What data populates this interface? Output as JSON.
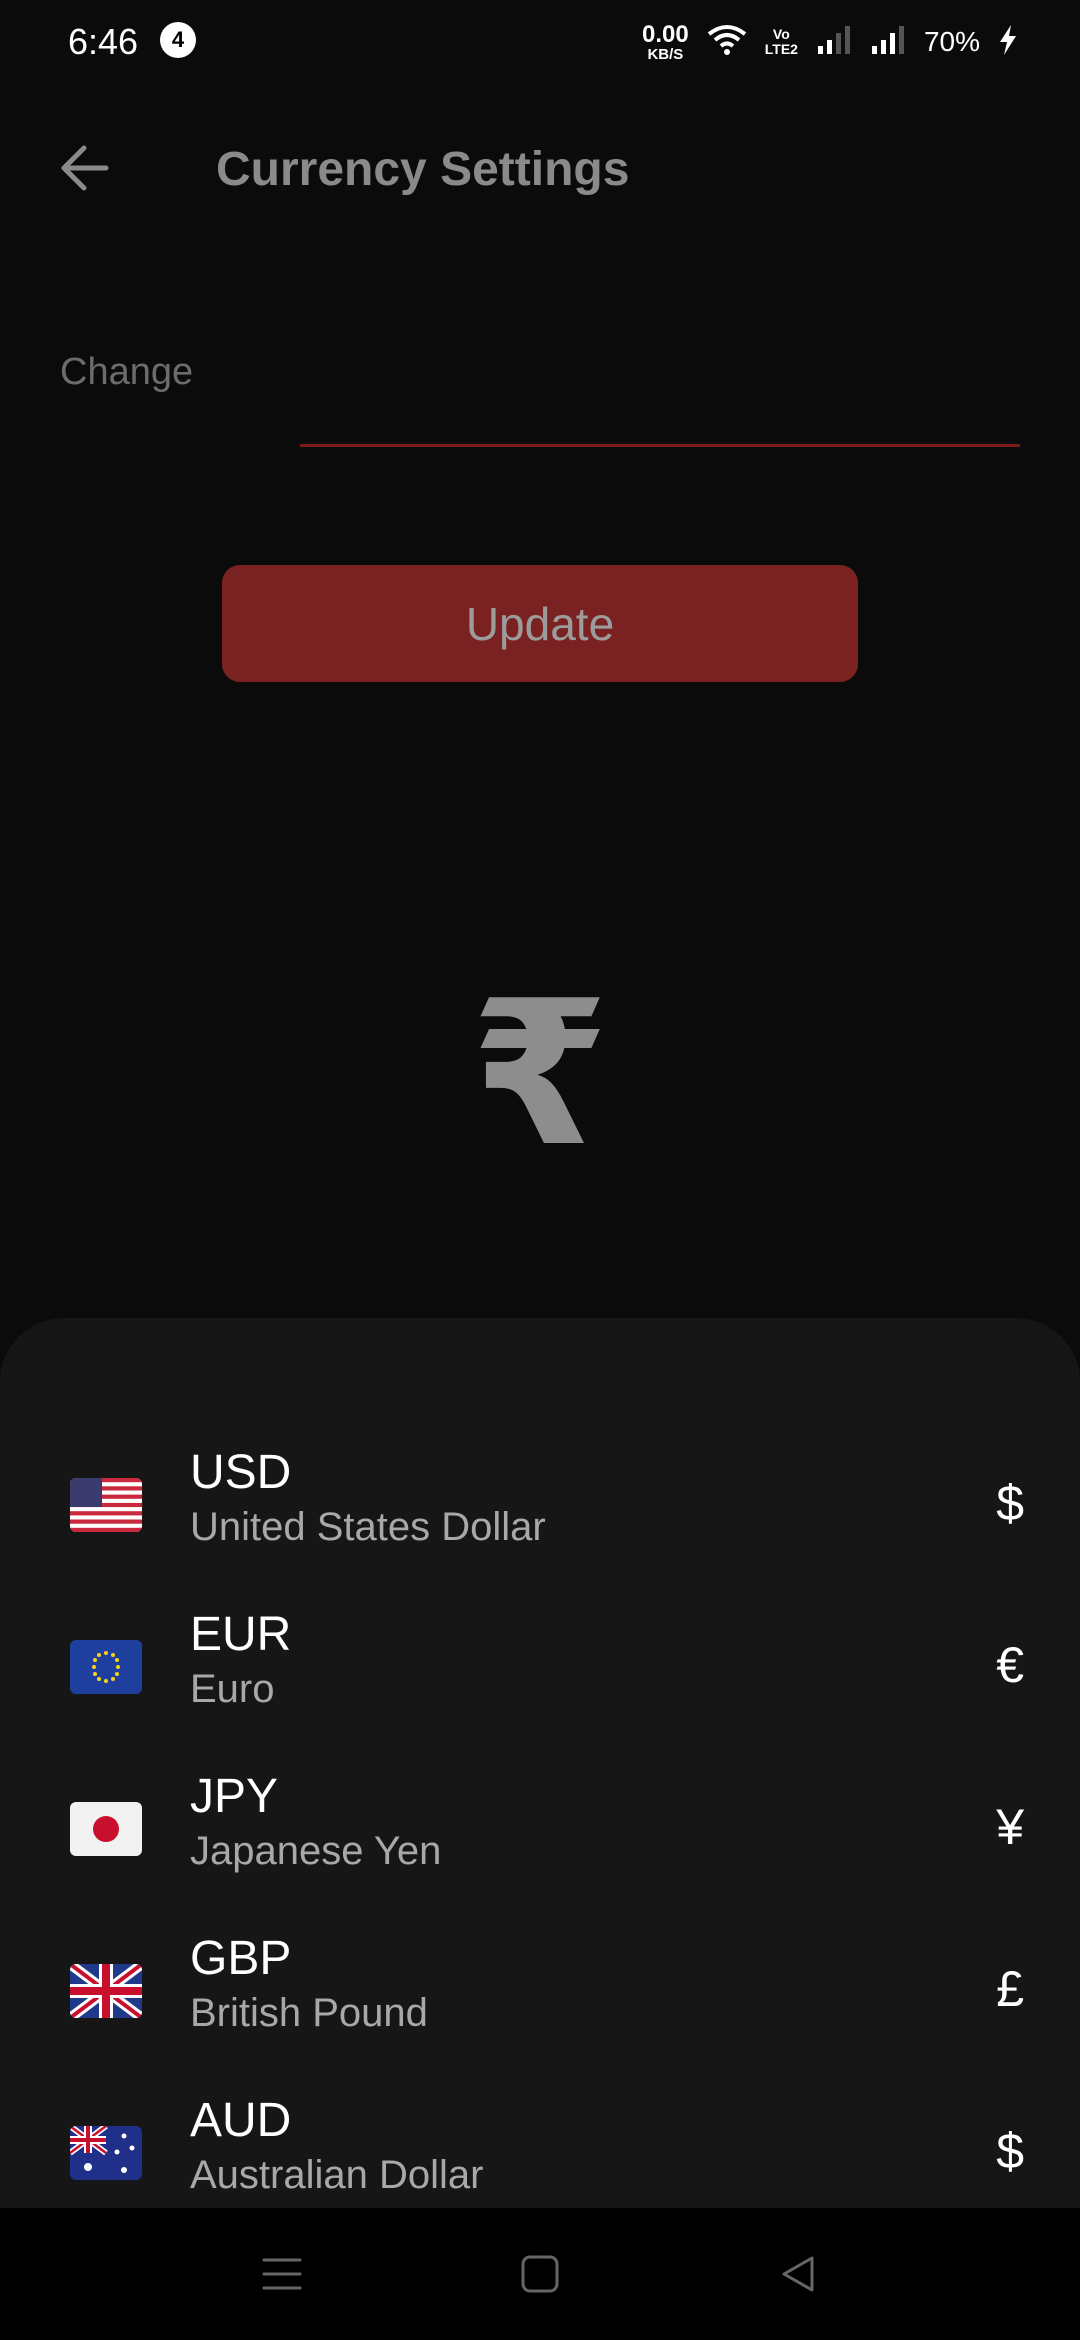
{
  "status_bar": {
    "time": "6:46",
    "notification_count": "4",
    "net_speed_value": "0.00",
    "net_speed_unit": "KB/S",
    "volte_top": "Vo",
    "volte_bottom": "LTE2",
    "battery": "70%"
  },
  "app_bar": {
    "title": "Currency Settings",
    "back_icon": "arrow-back-icon"
  },
  "form": {
    "change_label": "Change",
    "change_value": "",
    "change_placeholder": "",
    "update_label": "Update"
  },
  "current_symbol": "₹",
  "currencies": [
    {
      "code": "USD",
      "name": "United States Dollar",
      "symbol": "$",
      "flag": "us-flag-icon"
    },
    {
      "code": "EUR",
      "name": "Euro",
      "symbol": "€",
      "flag": "eu-flag-icon"
    },
    {
      "code": "JPY",
      "name": "Japanese Yen",
      "symbol": "¥",
      "flag": "jp-flag-icon"
    },
    {
      "code": "GBP",
      "name": "British Pound",
      "symbol": "£",
      "flag": "gb-flag-icon"
    },
    {
      "code": "AUD",
      "name": "Australian Dollar",
      "symbol": "$",
      "flag": "au-flag-icon"
    }
  ],
  "colors": {
    "background": "#0b0b0b",
    "sheet": "#161616",
    "accent": "#7a2222",
    "underline": "#7a1c1c"
  },
  "nav_bar": {
    "menu_icon": "menu-icon",
    "home_icon": "home-square-icon",
    "back_icon": "back-triangle-icon"
  }
}
